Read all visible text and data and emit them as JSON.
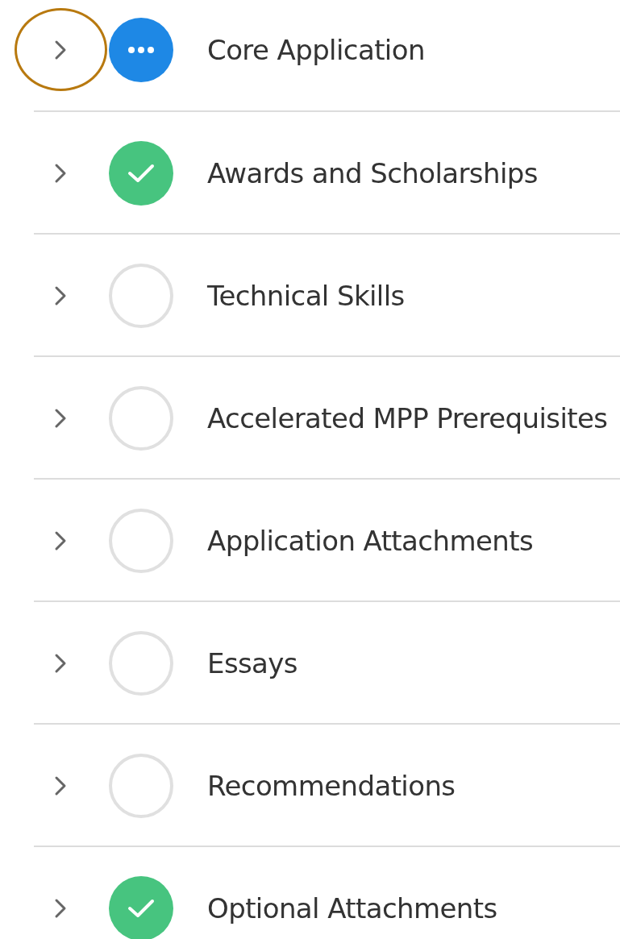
{
  "sections": [
    {
      "title": "Core Application",
      "kind": "in_progress",
      "highlighted": true
    },
    {
      "title": "Awards and Scholarships",
      "kind": "complete",
      "highlighted": false
    },
    {
      "title": "Technical Skills",
      "kind": "not_started",
      "highlighted": false
    },
    {
      "title": "Accelerated MPP Prerequisites",
      "kind": "not_started",
      "highlighted": false
    },
    {
      "title": "Application Attachments",
      "kind": "not_started",
      "highlighted": false
    },
    {
      "title": "Essays",
      "kind": "not_started",
      "highlighted": false
    },
    {
      "title": "Recommendations",
      "kind": "not_started",
      "highlighted": false
    },
    {
      "title": "Optional Attachments",
      "kind": "complete",
      "highlighted": false
    }
  ]
}
